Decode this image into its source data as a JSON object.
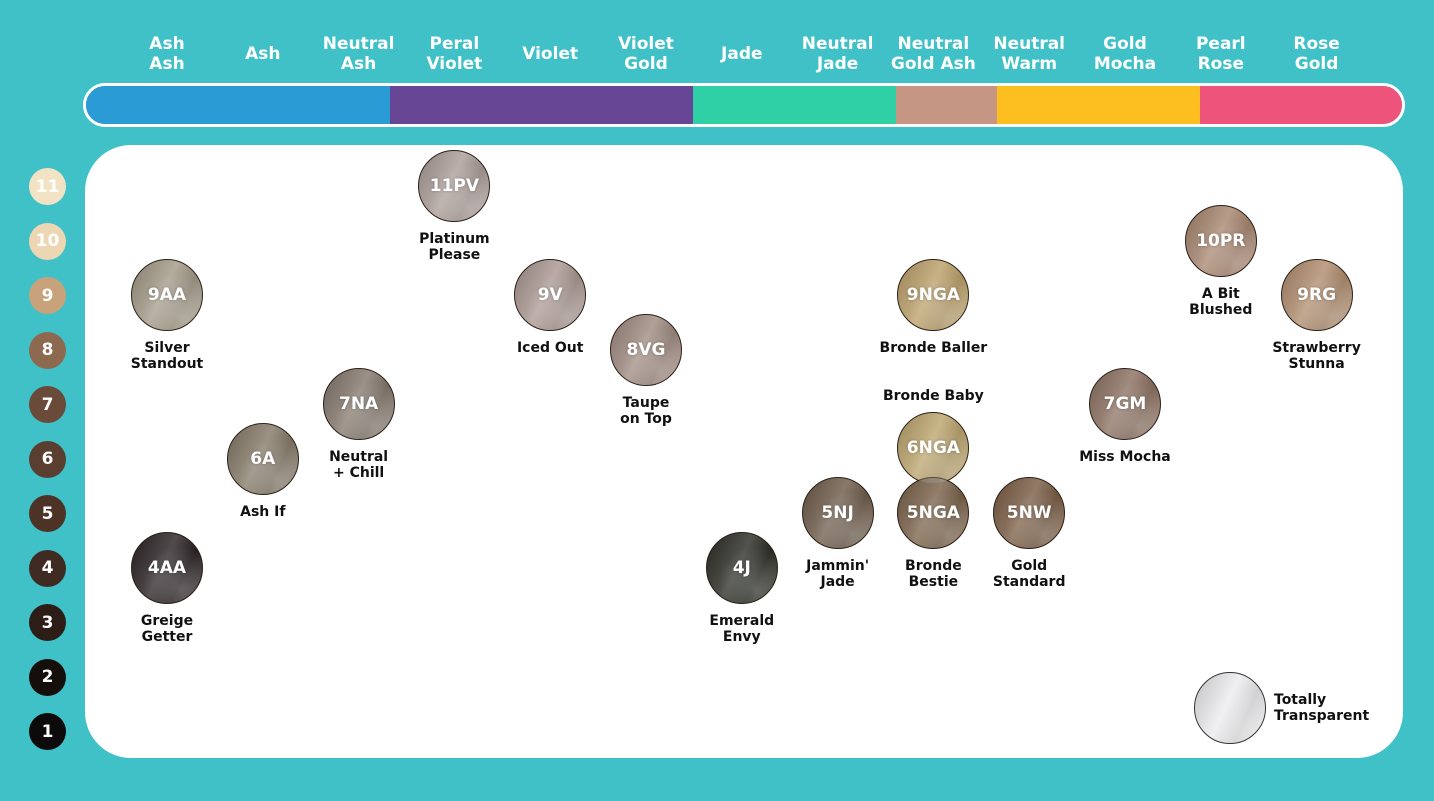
{
  "columns": [
    {
      "label": "Ash\nAsh"
    },
    {
      "label": "Ash"
    },
    {
      "label": "Neutral\nAsh"
    },
    {
      "label": "Peral\nViolet"
    },
    {
      "label": "Violet"
    },
    {
      "label": "Violet\nGold"
    },
    {
      "label": "Jade"
    },
    {
      "label": "Neutral\nJade"
    },
    {
      "label": "Neutral\nGold Ash"
    },
    {
      "label": "Neutral\nWarm"
    },
    {
      "label": "Gold\nMocha"
    },
    {
      "label": "Pearl\nRose"
    },
    {
      "label": "Rose\nGold"
    }
  ],
  "tone_bar": [
    {
      "family": "Ash",
      "color": "#2b9bd5",
      "span": 3
    },
    {
      "family": "Violet",
      "color": "#664695",
      "span": 3
    },
    {
      "family": "Jade",
      "color": "#2fd0a5",
      "span": 2
    },
    {
      "family": "Neutral Gold Ash",
      "color": "#c49683",
      "span": 1
    },
    {
      "family": "Warm/Gold",
      "color": "#fdbe1f",
      "span": 2
    },
    {
      "family": "Rose",
      "color": "#ed537b",
      "span": 2
    }
  ],
  "levels": [
    {
      "label": "11",
      "color": "#f2e3c5"
    },
    {
      "label": "10",
      "color": "#ecd6b3"
    },
    {
      "label": "9",
      "color": "#c8a27a"
    },
    {
      "label": "8",
      "color": "#8d6a4f"
    },
    {
      "label": "7",
      "color": "#6a4a38"
    },
    {
      "label": "6",
      "color": "#5a3e2f"
    },
    {
      "label": "5",
      "color": "#4c3326"
    },
    {
      "label": "4",
      "color": "#3f2b22"
    },
    {
      "label": "3",
      "color": "#2c1d17"
    },
    {
      "label": "2",
      "color": "#150f0c"
    },
    {
      "label": "1",
      "color": "#0c0a0b"
    }
  ],
  "shades": [
    {
      "code": "9AA",
      "name": "Silver\nStandout",
      "column": 0,
      "level": 9,
      "color": "#a39a88",
      "label_pos": "below"
    },
    {
      "code": "4AA",
      "name": "Greige\nGetter",
      "column": 0,
      "level": 4,
      "color": "#2a2325",
      "label_pos": "below"
    },
    {
      "code": "6A",
      "name": "Ash If",
      "column": 1,
      "level": 6,
      "color": "#857a68",
      "label_pos": "below"
    },
    {
      "code": "7NA",
      "name": "Neutral\n+ Chill",
      "column": 2,
      "level": 7,
      "color": "#85786d",
      "label_pos": "below"
    },
    {
      "code": "11PV",
      "name": "Platinum\nPlease",
      "column": 3,
      "level": 11,
      "color": "#ab9d98",
      "label_pos": "below"
    },
    {
      "code": "9V",
      "name": "Iced Out",
      "column": 4,
      "level": 9,
      "color": "#aa9892",
      "label_pos": "below"
    },
    {
      "code": "8VG",
      "name": "Taupe\non Top",
      "column": 5,
      "level": 8,
      "color": "#9f8b80",
      "label_pos": "below"
    },
    {
      "code": "4J",
      "name": "Emerald\nEnvy",
      "column": 6,
      "level": 4,
      "color": "#2b2d25",
      "label_pos": "below"
    },
    {
      "code": "5NJ",
      "name": "Jammin'\nJade",
      "column": 7,
      "level": 5,
      "color": "#6e5c4b",
      "label_pos": "below"
    },
    {
      "code": "9NGA",
      "name": "Bronde Baller",
      "column": 8,
      "level": 9,
      "color": "#bba06a",
      "label_pos": "below"
    },
    {
      "code": "6NGA",
      "name": "Bronde Baby",
      "column": 8,
      "level": 6.2,
      "color": "#bba46d",
      "label_pos": "above"
    },
    {
      "code": "5NGA",
      "name": "Bronde\nBestie",
      "column": 8,
      "level": 5,
      "color": "#7a6249",
      "label_pos": "below"
    },
    {
      "code": "5NW",
      "name": "Gold\nStandard",
      "column": 9,
      "level": 5,
      "color": "#7a5d45",
      "label_pos": "below"
    },
    {
      "code": "7GM",
      "name": "Miss Mocha",
      "column": 10,
      "level": 7,
      "color": "#8c7161",
      "label_pos": "below"
    },
    {
      "code": "10PR",
      "name": "A Bit\nBlushed",
      "column": 11,
      "level": 10,
      "color": "#a88670",
      "label_pos": "below"
    },
    {
      "code": "9RG",
      "name": "Strawberry\nStunna",
      "column": 12,
      "level": 9,
      "color": "#b08d6e",
      "label_pos": "below"
    }
  ],
  "transparent": {
    "name": "Totally\nTransparent",
    "color": "#ececee"
  }
}
